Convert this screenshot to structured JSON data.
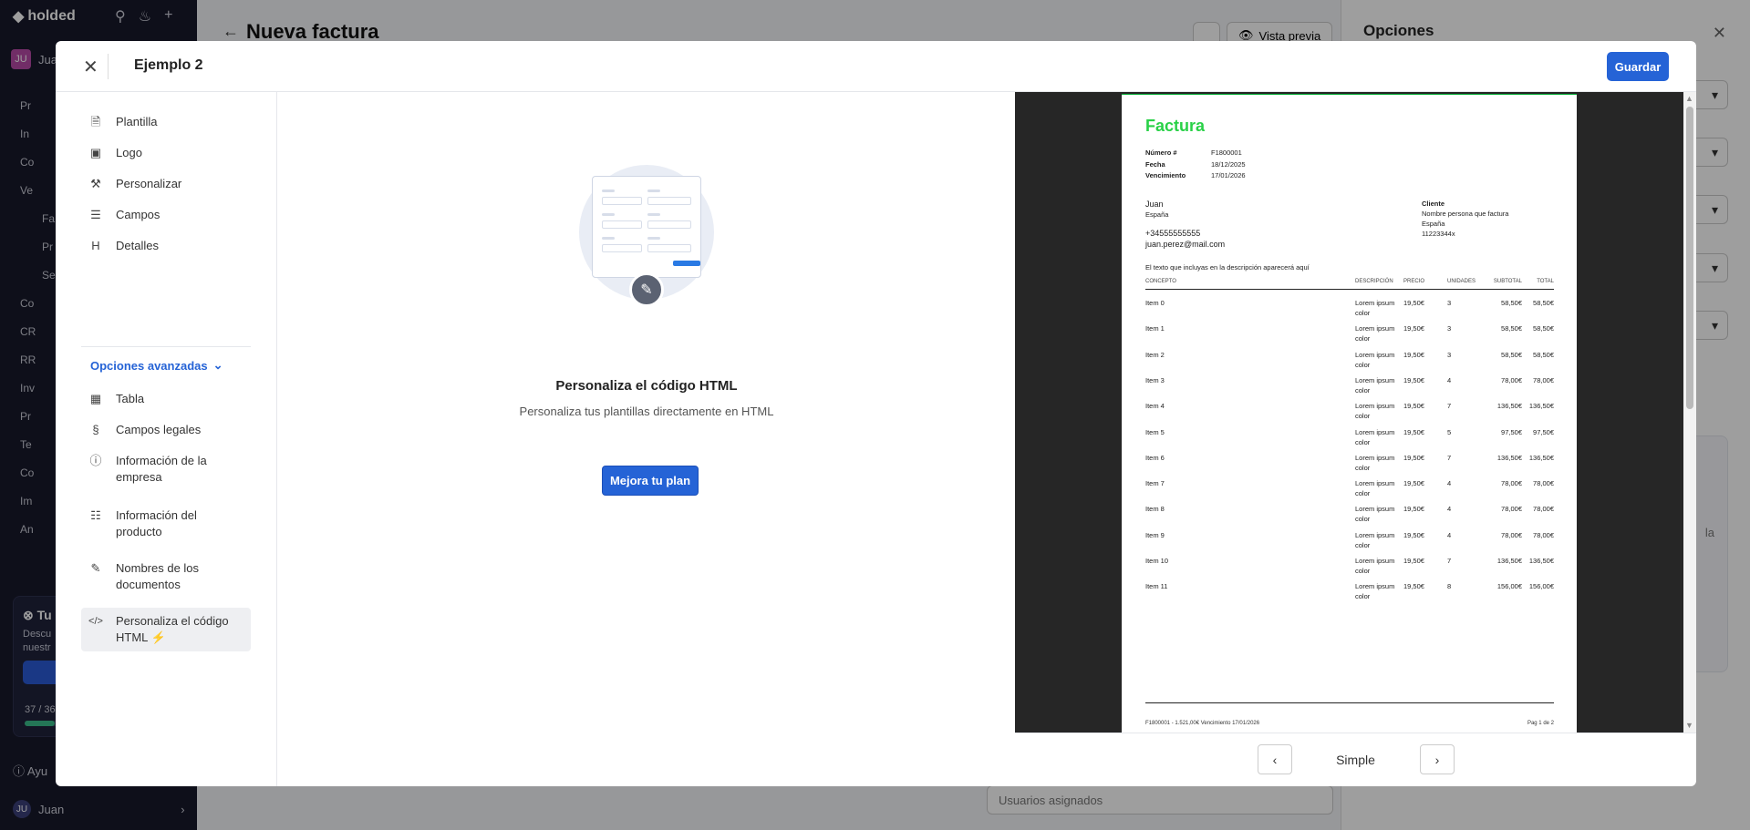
{
  "app": {
    "brand": "holded",
    "user_initials": "JU",
    "user_name": "Juan",
    "nav_fragments": [
      "Pr",
      "In",
      "Co",
      "Ve",
      "Fa",
      "Pr",
      "Se",
      "Co",
      "CR",
      "RR",
      "Inv",
      "Pr",
      "Te",
      "Co",
      "Im",
      "An"
    ],
    "promo_title": "Tu",
    "promo_text_1": "Descu",
    "promo_text_2": "nuestr",
    "progress_text": "37 / 36",
    "progress_fraction": 0.22,
    "help_label": "Ayu",
    "footer_user": "Juan",
    "page_title": "Nueva factura",
    "preview_label": "Vista previa",
    "assigned_users_placeholder": "Usuarios asignados",
    "options_title": "Opciones",
    "options_fragment": "la"
  },
  "modal": {
    "title": "Ejemplo 2",
    "save_label": "Guardar",
    "nav": [
      {
        "label": "Plantilla",
        "icon": "file-icon"
      },
      {
        "label": "Logo",
        "icon": "image-icon"
      },
      {
        "label": "Personalizar",
        "icon": "paint-roller-icon"
      },
      {
        "label": "Campos",
        "icon": "list-icon"
      },
      {
        "label": "Detalles",
        "icon": "heading-icon"
      }
    ],
    "advanced_label": "Opciones avanzadas",
    "advanced_nav": [
      {
        "label": "Tabla",
        "icon": "table-icon"
      },
      {
        "label": "Campos legales",
        "icon": "legal-icon"
      },
      {
        "label": "Información de la empresa",
        "icon": "info-icon"
      },
      {
        "label": "Información del producto",
        "icon": "product-list-icon"
      },
      {
        "label": "Nombres de los documentos",
        "icon": "edit-icon"
      },
      {
        "label": "Personaliza el código HTML ⚡",
        "icon": "code-icon",
        "active": true
      }
    ],
    "center": {
      "title": "Personaliza el código HTML",
      "description": "Personaliza tus plantillas directamente en HTML",
      "button": "Mejora tu plan"
    },
    "preview": {
      "template_name": "Simple",
      "invoice": {
        "title": "Factura",
        "meta": [
          {
            "key": "Número #",
            "value": "F1800001"
          },
          {
            "key": "Fecha",
            "value": "18/12/2025"
          },
          {
            "key": "Vencimiento",
            "value": "17/01/2026"
          }
        ],
        "issuer": {
          "name": "Juan",
          "country": "España",
          "phone": "+34555555555",
          "email": "juan.perez@mail.com"
        },
        "client": {
          "label": "Cliente",
          "name": "Nombre persona que factura",
          "country": "España",
          "id": "11223344x"
        },
        "note": "El texto que incluyas en la descripción aparecerá aquí",
        "columns": [
          "CONCEPTO",
          "DESCRIPCIÓN",
          "PRECIO",
          "UNIDADES",
          "SUBTOTAL",
          "TOTAL"
        ],
        "rows": [
          {
            "concept": "Item 0",
            "desc": "Lorem ipsum color",
            "price": "19,50€",
            "units": "3",
            "subtotal": "58,50€",
            "total": "58,50€"
          },
          {
            "concept": "Item 1",
            "desc": "Lorem ipsum color",
            "price": "19,50€",
            "units": "3",
            "subtotal": "58,50€",
            "total": "58,50€"
          },
          {
            "concept": "Item 2",
            "desc": "Lorem ipsum color",
            "price": "19,50€",
            "units": "3",
            "subtotal": "58,50€",
            "total": "58,50€"
          },
          {
            "concept": "Item 3",
            "desc": "Lorem ipsum color",
            "price": "19,50€",
            "units": "4",
            "subtotal": "78,00€",
            "total": "78,00€"
          },
          {
            "concept": "Item 4",
            "desc": "Lorem ipsum color",
            "price": "19,50€",
            "units": "7",
            "subtotal": "136,50€",
            "total": "136,50€"
          },
          {
            "concept": "Item 5",
            "desc": "Lorem ipsum color",
            "price": "19,50€",
            "units": "5",
            "subtotal": "97,50€",
            "total": "97,50€"
          },
          {
            "concept": "Item 6",
            "desc": "Lorem ipsum color",
            "price": "19,50€",
            "units": "7",
            "subtotal": "136,50€",
            "total": "136,50€"
          },
          {
            "concept": "Item 7",
            "desc": "Lorem ipsum color",
            "price": "19,50€",
            "units": "4",
            "subtotal": "78,00€",
            "total": "78,00€"
          },
          {
            "concept": "Item 8",
            "desc": "Lorem ipsum color",
            "price": "19,50€",
            "units": "4",
            "subtotal": "78,00€",
            "total": "78,00€"
          },
          {
            "concept": "Item 9",
            "desc": "Lorem ipsum color",
            "price": "19,50€",
            "units": "4",
            "subtotal": "78,00€",
            "total": "78,00€"
          },
          {
            "concept": "Item 10",
            "desc": "Lorem ipsum color",
            "price": "19,50€",
            "units": "7",
            "subtotal": "136,50€",
            "total": "136,50€"
          },
          {
            "concept": "Item 11",
            "desc": "Lorem ipsum color",
            "price": "19,50€",
            "units": "8",
            "subtotal": "156,00€",
            "total": "156,00€"
          }
        ],
        "footer_left": "F1800001 - 1.521,00€ Vencimiento 17/01/2026",
        "footer_right": "Pag 1 de 2"
      }
    }
  },
  "colors": {
    "accent": "#2563d6",
    "invoice_title": "#29d147",
    "preview_bg": "#262626"
  }
}
